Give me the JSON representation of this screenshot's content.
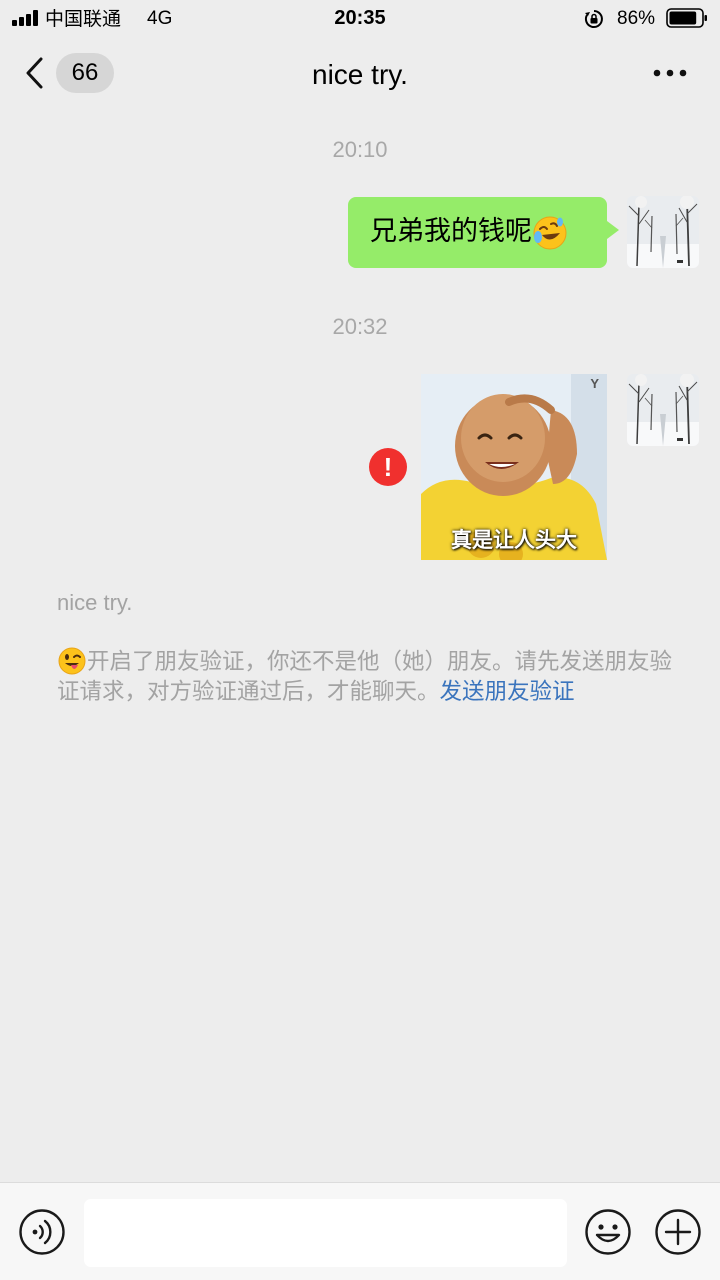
{
  "status_bar": {
    "carrier": "中国联通",
    "network": "4G",
    "time": "20:35",
    "battery_percent": "86%",
    "battery_level": 0.86
  },
  "header": {
    "unread_count": "66",
    "title": "nice try."
  },
  "messages": [
    {
      "timestamp": "20:10",
      "text": "兄弟我的钱呢",
      "emoji": "rolling-on-floor-laughing-emoji"
    },
    {
      "timestamp": "20:32",
      "sticker_caption": "真是让人头大",
      "sticker_mark": "Y",
      "send_failed": true,
      "error_symbol": "!"
    }
  ],
  "system_notice": {
    "contact_name": "nice try.",
    "emoji": "winking-face-with-tongue-emoji",
    "text": "开启了朋友验证，你还不是他（她）朋友。请先发送朋友验证请求，对方验证通过后，才能聊天。",
    "link": "发送朋友验证"
  },
  "input_bar": {
    "placeholder": ""
  },
  "colors": {
    "background": "#ededed",
    "bubble": "#95ec69",
    "error": "#f0302e",
    "link": "#3a74bd",
    "muted_text": "#a3a3a3"
  }
}
